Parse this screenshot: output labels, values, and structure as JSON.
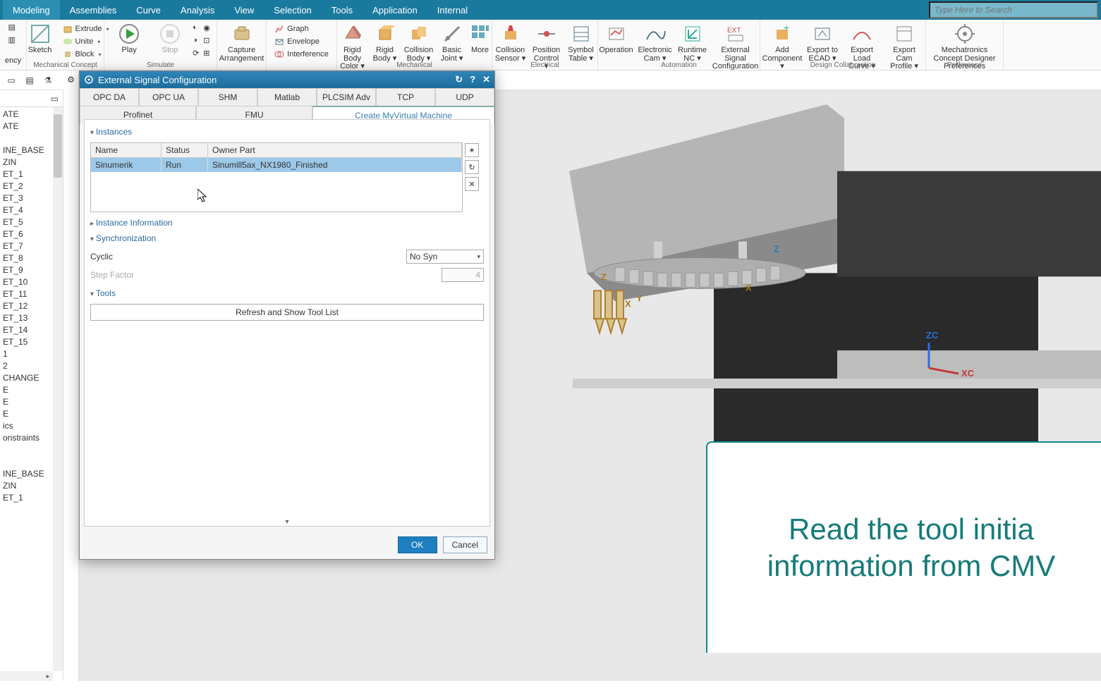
{
  "menubar": {
    "items": [
      "Modeling",
      "Assemblies",
      "Curve",
      "Analysis",
      "View",
      "Selection",
      "Tools",
      "Application",
      "Internal"
    ],
    "search_placeholder": "Type Here to Search"
  },
  "ribbon": {
    "sketch": "Sketch",
    "extrude": "Extrude",
    "unite": "Unite",
    "block": "Block",
    "play": "Play",
    "stop": "Stop",
    "capture": "Capture Arrangement",
    "graph": "Graph",
    "envelope": "Envelope",
    "interference": "Interference",
    "rigid_body_color": "Rigid Body Color ▾",
    "rigid_body": "Rigid Body ▾",
    "collision_body": "Collision Body ▾",
    "basic_joint": "Basic Joint ▾",
    "more_mech": "More",
    "collision_sensor": "Collision Sensor ▾",
    "position_control": "Position Control ▾",
    "symbol_table": "Symbol Table ▾",
    "operation": "Operation",
    "electronic_cam": "Electronic Cam ▾",
    "runtime_nc": "Runtime NC ▾",
    "ext_signal": "External Signal Configuration ▾",
    "add_component": "Add Component ▾",
    "export_ecad": "Export to ECAD ▾",
    "export_load_curve": "Export Load Curve ▾",
    "export_cam_profile": "Export Cam Profile ▾",
    "mech_pref": "Mechatronics Concept Designer Preferences",
    "grp_mechconcept": "Mechanical Concept",
    "grp_simulate": "Simulate",
    "grp_mechanical": "Mechanical",
    "grp_electrical": "Electrical",
    "grp_automation": "Automation",
    "grp_design": "Design Collaboration",
    "grp_preference": "Preference",
    "ency": "ency"
  },
  "tree": {
    "items": [
      "ATE",
      "ATE",
      "",
      "INE_BASE",
      "ZIN",
      "ET_1",
      "ET_2",
      "ET_3",
      "ET_4",
      "ET_5",
      "ET_6",
      "ET_7",
      "ET_8",
      "ET_9",
      "ET_10",
      "ET_11",
      "ET_12",
      "ET_13",
      "ET_14",
      "ET_15",
      "1",
      "2",
      "CHANGE",
      "E",
      "E",
      "E",
      "ics",
      "onstraints",
      "",
      "",
      "INE_BASE",
      "ZIN",
      "ET_1"
    ]
  },
  "dialog": {
    "title": "External Signal Configuration",
    "tabs_top": [
      "OPC DA",
      "OPC UA",
      "SHM",
      "Matlab",
      "PLCSIM Adv",
      "TCP",
      "UDP"
    ],
    "tabs_row2": [
      "Profinet",
      "FMU",
      "Create MyVirtual Machine"
    ],
    "sec_instances": "Instances",
    "sec_instance_info": "Instance Information",
    "sec_sync": "Synchronization",
    "sec_tools": "Tools",
    "col_name": "Name",
    "col_status": "Status",
    "col_owner": "Owner Part",
    "row_name": "Sinumerik",
    "row_status": "Run",
    "row_owner": "Sinumill5ax_NX1980_Finished",
    "cyclic_label": "Cyclic",
    "cyclic_value": "No Syn",
    "step_label": "Step Factor",
    "step_value": "4",
    "refresh_btn": "Refresh and Show Tool List",
    "ok": "OK",
    "cancel": "Cancel"
  },
  "axes": {
    "x": "X",
    "y": "Y",
    "z": "Z",
    "xc": "XC",
    "zc": "ZC"
  },
  "callout": {
    "line1": "Read the tool initia",
    "line2": "information from CMV"
  }
}
